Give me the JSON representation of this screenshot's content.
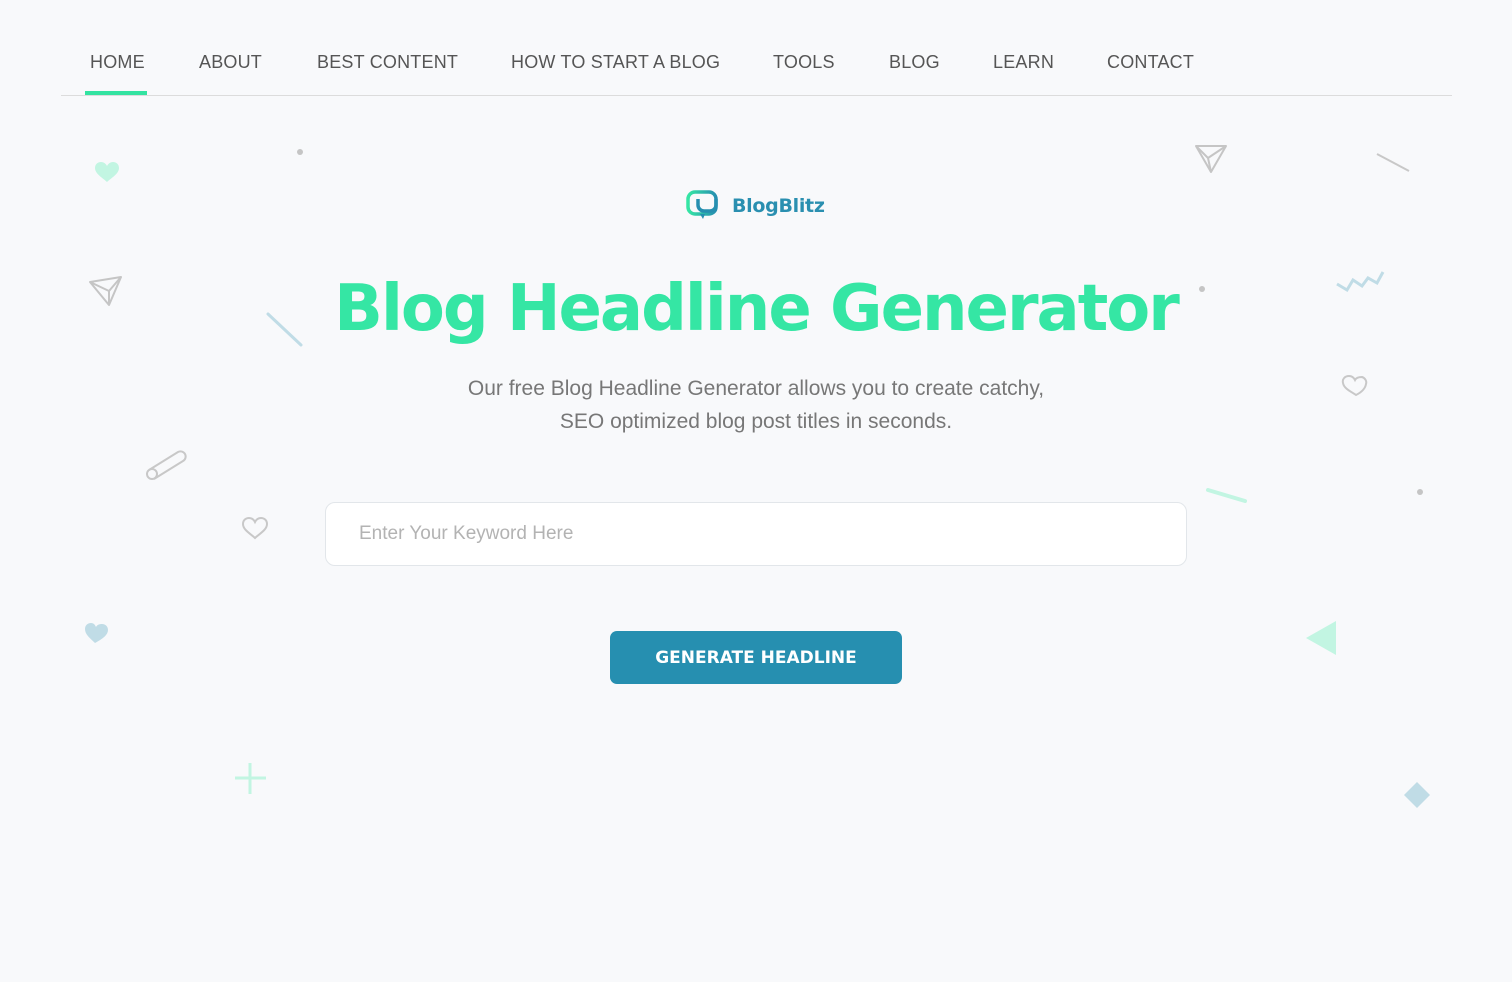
{
  "nav": {
    "items": [
      {
        "label": "HOME",
        "active": true
      },
      {
        "label": "ABOUT"
      },
      {
        "label": "BEST CONTENT"
      },
      {
        "label": "HOW TO START A BLOG"
      },
      {
        "label": "TOOLS"
      },
      {
        "label": "BLOG"
      },
      {
        "label": "LEARN"
      },
      {
        "label": "CONTACT"
      }
    ]
  },
  "brand": {
    "name": "BlogBlitz",
    "icon": "chat-bubble-logo-icon"
  },
  "hero": {
    "title": "Blog Headline Generator",
    "subtitle_line1": "Our free Blog Headline Generator allows you to create catchy,",
    "subtitle_line2": "SEO optimized blog post titles in seconds."
  },
  "form": {
    "keyword_value": "",
    "keyword_placeholder": "Enter Your Keyword Here",
    "generate_label": "GENERATE HEADLINE"
  },
  "colors": {
    "accent_green": "#35e6a4",
    "brand_blue": "#268fb0",
    "background": "#f8f9fb"
  }
}
